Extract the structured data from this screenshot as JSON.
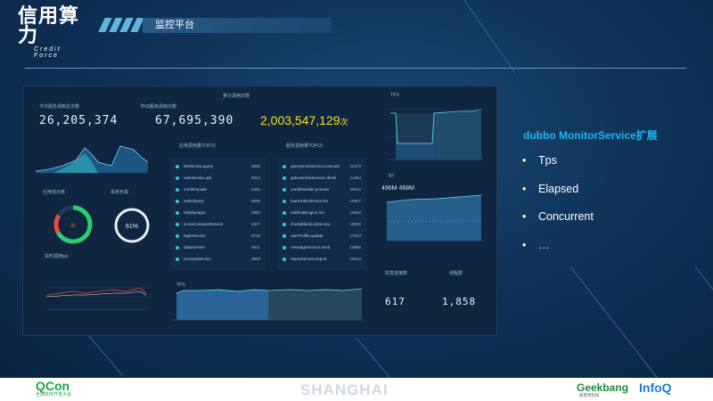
{
  "logo": {
    "cn": "信用算力",
    "en": "Credit Force"
  },
  "header": {
    "title": "监控平台"
  },
  "dashboard": {
    "stat1": {
      "label": "今日服务调用总次数",
      "value": "26,205,374"
    },
    "stat2": {
      "label": "昨日服务调用次数",
      "value": "67,695,390"
    },
    "stat3": {
      "label": "累计调用次数",
      "value": "2,003,547,129",
      "suffix": "次"
    },
    "gauge1_label": "应用成功率",
    "gauge1_value": "0k",
    "gauge2_label": "系统负载",
    "gauge2_value": "61%",
    "chart3_label": "实时调用tps",
    "list1": {
      "title": "应用调用量TOP10",
      "rows": [
        {
          "name": "bizService.query",
          "num": "6835"
        },
        {
          "name": "userService.get",
          "num": "6614"
        },
        {
          "name": "creditFacade",
          "num": "6401"
        },
        {
          "name": "orderQuery",
          "num": "6058"
        },
        {
          "name": "riskManager",
          "num": "5954"
        },
        {
          "name": "scoreComputeService",
          "num": "5827"
        },
        {
          "name": "loginService",
          "num": "5715"
        },
        {
          "name": "dataService",
          "num": "5611"
        },
        {
          "name": "accountService",
          "num": "5503"
        }
      ]
    },
    "list2": {
      "title": "服务调用量TOP10",
      "rows": [
        {
          "name": "queryScoreService.execute",
          "num": "22275"
        },
        {
          "name": "getUserInfoService.check",
          "num": "21354"
        },
        {
          "name": "creditHandler.process",
          "num": "20612"
        },
        {
          "name": "loanOrderService.list",
          "num": "19877"
        },
        {
          "name": "riskRuleEngine.run",
          "num": "18950"
        },
        {
          "name": "checkBlackListService",
          "num": "18502"
        },
        {
          "name": "userProfile.update",
          "num": "17613"
        },
        {
          "name": "messageService.send",
          "num": "16890"
        },
        {
          "name": "reportService.export",
          "num": "16044"
        }
      ]
    },
    "tps_label": "TPS",
    "rt_label": "RT",
    "rt_value": "496M 468M",
    "bottom_left_label": "并发连接数",
    "bottom_right_label": "线程数",
    "bottom_left_value": "617",
    "bottom_right_value": "1,858"
  },
  "right": {
    "title": "dubbo MonitorService扩展",
    "items": [
      "Tps",
      "Elapsed",
      "Concurrent",
      "…"
    ]
  },
  "footer": {
    "qcon": "QCon",
    "qcon_sub": "全球软件开发大会",
    "city": "SHANGHAI",
    "geek": "Geekbang",
    "geek_sub": "极客邦科技",
    "infoq": "InfoQ"
  },
  "colors": {
    "accent": "#22b4f0",
    "highlight": "#f6e21c",
    "panel": "#0f2540"
  }
}
